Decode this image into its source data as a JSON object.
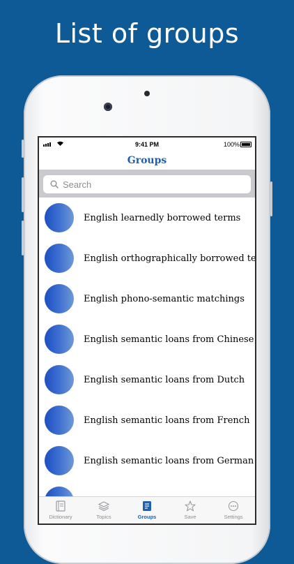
{
  "headline": "List of groups",
  "status_bar": {
    "time": "9:41 PM",
    "battery": "100%"
  },
  "nav": {
    "title": "Groups"
  },
  "search": {
    "placeholder": "Search"
  },
  "groups": [
    {
      "label": "English learnedly borrowed terms"
    },
    {
      "label": "English orthographically borrowed terms"
    },
    {
      "label": "English phono-semantic matchings"
    },
    {
      "label": "English semantic loans from Chinese"
    },
    {
      "label": "English semantic loans from Dutch"
    },
    {
      "label": "English semantic loans from French"
    },
    {
      "label": "English semantic loans from German"
    },
    {
      "label": ""
    }
  ],
  "tabs": [
    {
      "label": "Dictionary",
      "icon": "dictionary-icon"
    },
    {
      "label": "Topics",
      "icon": "topics-icon"
    },
    {
      "label": "Groups",
      "icon": "groups-icon",
      "active": true
    },
    {
      "label": "Save",
      "icon": "star-icon"
    },
    {
      "label": "Settings",
      "icon": "settings-icon"
    }
  ],
  "colors": {
    "background": "#0d5a96",
    "accent": "#1f5fad",
    "avatar": "#3a6cd0"
  }
}
